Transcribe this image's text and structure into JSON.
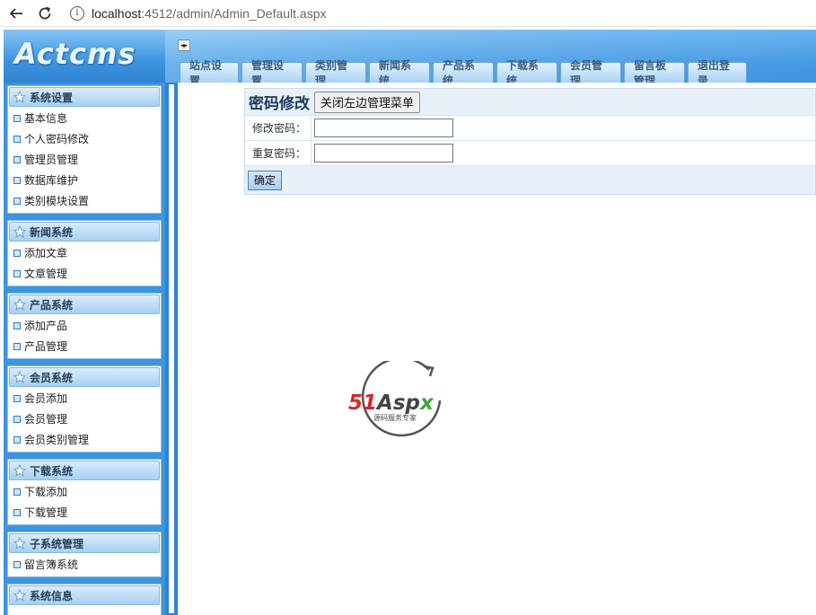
{
  "browser": {
    "url_host": "localhost",
    "url_path": ":4512/admin/Admin_Default.aspx"
  },
  "header": {
    "logo_text": "Actcms",
    "toggle_glyph": "◂▸",
    "tabs": [
      {
        "label": "站点设置"
      },
      {
        "label": "管理设置"
      },
      {
        "label": "类别管理"
      },
      {
        "label": "新闻系统"
      },
      {
        "label": "产品系统"
      },
      {
        "label": "下载系统"
      },
      {
        "label": "会员管理"
      },
      {
        "label": "留言板管理"
      },
      {
        "label": "退出登录"
      }
    ]
  },
  "sidebar": {
    "groups": [
      {
        "title": "系统设置",
        "items": [
          "基本信息",
          "个人密码修改",
          "管理员管理",
          "数据库维护",
          "类别模块设置"
        ]
      },
      {
        "title": "新闻系统",
        "items": [
          "添加文章",
          "文章管理"
        ]
      },
      {
        "title": "产品系统",
        "items": [
          "添加产品",
          "产品管理"
        ]
      },
      {
        "title": "会员系统",
        "items": [
          "会员添加",
          "会员管理",
          "会员类别管理"
        ]
      },
      {
        "title": "下载系统",
        "items": [
          "下载添加",
          "下载管理"
        ]
      },
      {
        "title": "子系统管理",
        "items": [
          "留言簿系统"
        ]
      },
      {
        "title": "系统信息",
        "items": []
      }
    ]
  },
  "main": {
    "title": "密码修改",
    "close_menu_label": "关闭左边管理菜单",
    "fields": [
      {
        "label": "修改密码：",
        "value": ""
      },
      {
        "label": "重复密码：",
        "value": ""
      }
    ],
    "submit_label": "确定"
  },
  "watermark": {
    "brand": "51Aspx",
    "tagline": "源码服务专家"
  },
  "colors": {
    "header_blue": "#3d94e0",
    "tab_text": "#3c5c7c",
    "panel_bg": "#e8f1fa"
  }
}
